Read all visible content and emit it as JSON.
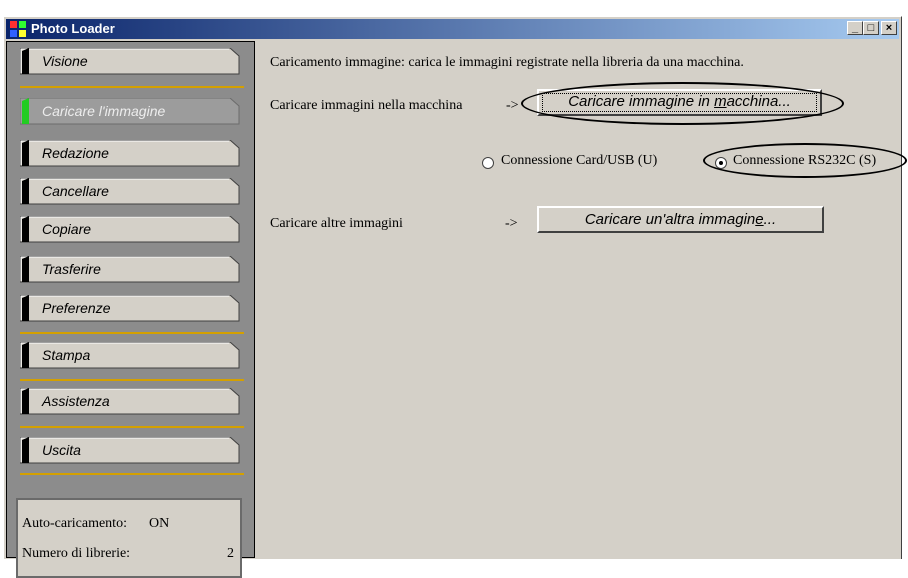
{
  "window": {
    "title": "Photo Loader",
    "minimize": "_",
    "maximize": "□",
    "close": "×"
  },
  "sidebar": {
    "items": [
      {
        "label": "Visione"
      },
      {
        "label": "Caricare l'immagine",
        "active": true
      },
      {
        "label": "Redazione"
      },
      {
        "label": "Cancellare"
      },
      {
        "label": "Copiare"
      },
      {
        "label": "Trasferire"
      },
      {
        "label": "Preferenze"
      },
      {
        "label": "Stampa"
      },
      {
        "label": "Assistenza"
      },
      {
        "label": "Uscita"
      }
    ],
    "info": {
      "autoload_label": "Auto-caricamento:",
      "autoload_value": "ON",
      "libraries_label": "Numero di librerie:",
      "libraries_value": "2"
    }
  },
  "main": {
    "description": "Caricamento immagine: carica le immagini registrate nella libreria da una macchina.",
    "load_camera_label": "Caricare immagini nella macchina",
    "arrow1": "->",
    "load_camera_button_pre": "Caricare immagine in ",
    "load_camera_button_mnemonic": "m",
    "load_camera_button_post": "acchina...",
    "radio_card_label": "Connessione Card/USB (U)",
    "radio_rs232_label": "Connessione RS232C (S)",
    "selected_connection": "RS232C",
    "load_other_label": "Caricare altre immagini",
    "arrow2": "->",
    "load_other_button_pre": "Caricare un'altra immagin",
    "load_other_button_mnemonic": "e",
    "load_other_button_post": "..."
  },
  "colors": {
    "accent_sep": "#d4a000",
    "active_marker": "#22cc22",
    "sidebar_bg": "#8c8c8c",
    "window_bg": "#d4d0c8",
    "title_start": "#0a246a",
    "title_end": "#a6caf0"
  }
}
